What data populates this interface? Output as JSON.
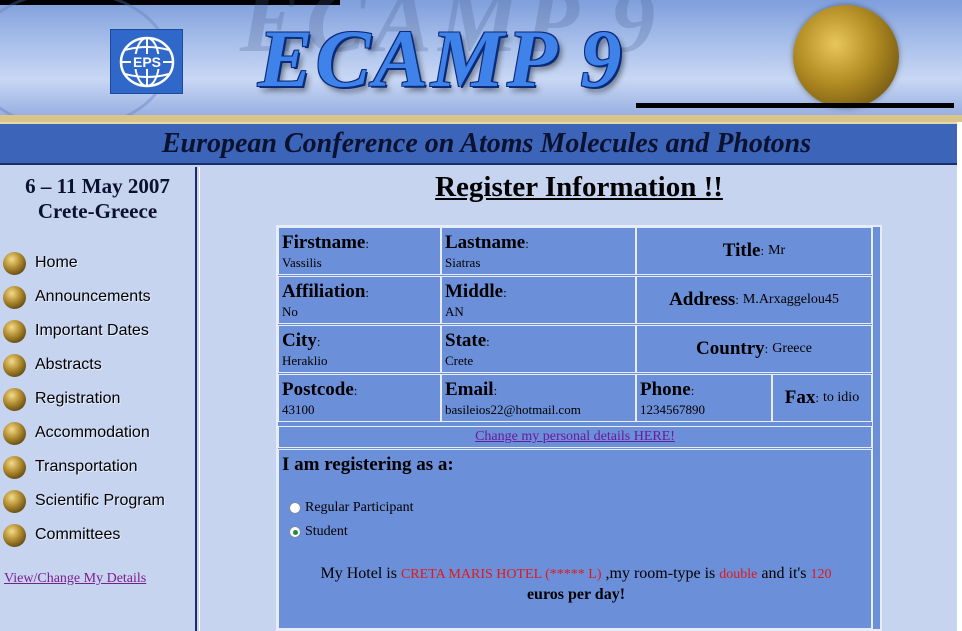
{
  "banner": {
    "logo_text": "EPS",
    "title": "ECAMP 9",
    "subtitle": "European Conference on Atoms Molecules and Photons"
  },
  "sidebar": {
    "dates": "6 – 11 May 2007",
    "location": "Crete-Greece",
    "items": [
      {
        "label": "Home"
      },
      {
        "label": "Announcements"
      },
      {
        "label": "Important Dates"
      },
      {
        "label": "Abstracts"
      },
      {
        "label": "Registration"
      },
      {
        "label": "Accommodation"
      },
      {
        "label": "Transportation"
      },
      {
        "label": "Scientific Program"
      },
      {
        "label": "Committees"
      }
    ],
    "my_details_link": "View/Change My Details"
  },
  "main": {
    "heading": "Register Information !!",
    "fields": {
      "firstname": {
        "label": "Firstname",
        "value": "Vassilis"
      },
      "lastname": {
        "label": "Lastname",
        "value": "Siatras"
      },
      "title": {
        "label": "Title",
        "value": "Mr"
      },
      "affiliation": {
        "label": "Affiliation",
        "value": "No"
      },
      "middle": {
        "label": "Middle",
        "value": "AN"
      },
      "address": {
        "label": "Address",
        "value": "M.Arxaggelou45"
      },
      "city": {
        "label": "City",
        "value": "Heraklio"
      },
      "state": {
        "label": "State",
        "value": "Crete"
      },
      "country": {
        "label": "Country",
        "value": "Greece"
      },
      "postcode": {
        "label": "Postcode",
        "value": "43100"
      },
      "email": {
        "label": "Email",
        "value": "basileios22@hotmail.com"
      },
      "phone": {
        "label": "Phone",
        "value": "1234567890"
      },
      "fax": {
        "label": "Fax",
        "value": "to idio"
      }
    },
    "colon": ":",
    "change_link": "Change my personal details HERE!",
    "registering_label": "I am registering as a:",
    "options": [
      {
        "label": "Regular Participant",
        "selected": false
      },
      {
        "label": "Student",
        "selected": true
      }
    ],
    "hotel": {
      "prefix": "My Hotel is",
      "name": "CRETA MARIS HOTEL (***** L)",
      "room_prefix": ",my room-type is",
      "room_type": "double",
      "price_prefix": "and it's",
      "price": "120",
      "suffix": "euros per day!"
    }
  },
  "colors": {
    "panel": "#6b8fd8",
    "page": "#c6d4f0",
    "subtitle_bar": "#3c64b8",
    "highlight_red": "#e01818",
    "link_purple": "#7a1f8c"
  }
}
